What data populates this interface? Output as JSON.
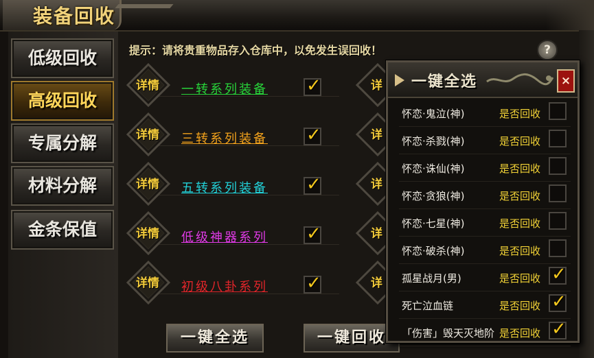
{
  "window": {
    "title": "装备回收"
  },
  "sidebar": {
    "items": [
      {
        "label": "低级回收",
        "active": false
      },
      {
        "label": "高级回收",
        "active": true
      },
      {
        "label": "专属分解",
        "active": false
      },
      {
        "label": "材料分解",
        "active": false
      },
      {
        "label": "金条保值",
        "active": false
      }
    ]
  },
  "main": {
    "tip": "提示：请将贵重物品存入仓库中，以免发生误回收！",
    "help_icon": "question-icon",
    "rows": [
      {
        "detail_label": "详情",
        "name": "一转系列装备",
        "color": "#28d43a",
        "checked": true
      },
      {
        "detail_label": "详情",
        "name": "三转系列装备",
        "color": "#f2a21c",
        "checked": true
      },
      {
        "detail_label": "详情",
        "name": "五转系列装备",
        "color": "#22d1d8",
        "checked": true
      },
      {
        "detail_label": "详情",
        "name": "低级神器系列",
        "color": "#e03ae6",
        "checked": true
      },
      {
        "detail_label": "详情",
        "name": "初级八卦系列",
        "color": "#e2252a",
        "checked": true
      }
    ],
    "ghost_label": "详",
    "buttons": {
      "select_all": "一键全选",
      "recycle": "一键回收"
    }
  },
  "panel": {
    "title": "一键全选",
    "close_label": "×",
    "items": [
      {
        "name": "怀恋·鬼泣(神)",
        "question": "是否回收",
        "checked": false
      },
      {
        "name": "怀恋·杀戮(神)",
        "question": "是否回收",
        "checked": false
      },
      {
        "name": "怀恋·诛仙(神)",
        "question": "是否回收",
        "checked": false
      },
      {
        "name": "怀恋·贪狼(神)",
        "question": "是否回收",
        "checked": false
      },
      {
        "name": "怀恋·七星(神)",
        "question": "是否回收",
        "checked": false
      },
      {
        "name": "怀恋·破杀(神)",
        "question": "是否回收",
        "checked": false
      },
      {
        "name": "孤星战月(男)",
        "question": "是否回收",
        "checked": true
      },
      {
        "name": "死亡泣血链",
        "question": "是否回收",
        "checked": true
      },
      {
        "name": "「伤害」毁天灭地阶",
        "question": "是否回收",
        "checked": true
      }
    ]
  }
}
